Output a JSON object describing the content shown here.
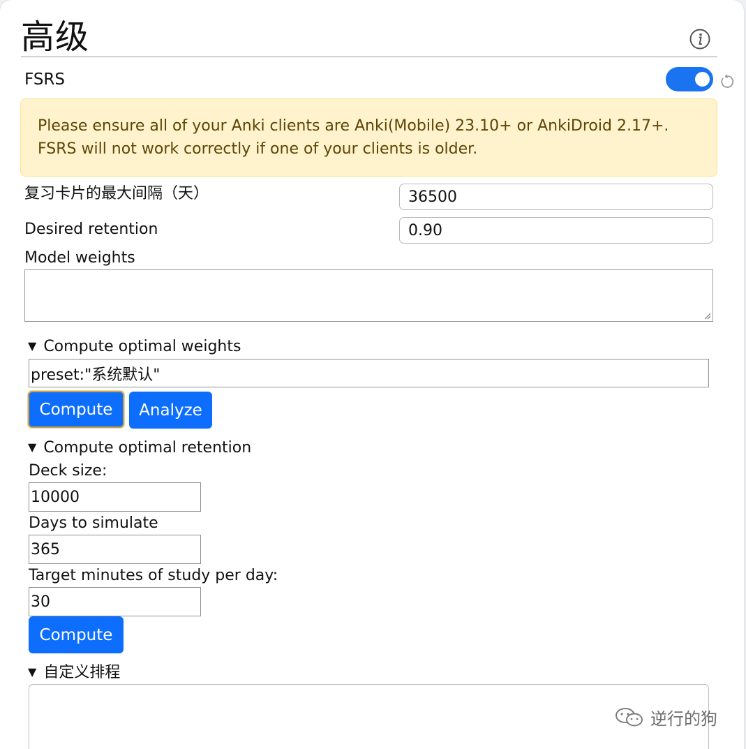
{
  "header": {
    "title": "高级",
    "info_icon": "info-icon"
  },
  "fsrs": {
    "label": "FSRS",
    "enabled": true,
    "toggle_color": "#1a73f0",
    "revert_icon": "revert-icon"
  },
  "warning": {
    "text": "Please ensure all of your Anki clients are Anki(Mobile) 23.10+ or AnkiDroid 2.17+. FSRS will not work correctly if one of your clients is older."
  },
  "settings": {
    "max_interval": {
      "label": "复习卡片的最大间隔（天）",
      "value": "36500"
    },
    "desired_retention": {
      "label": "Desired retention",
      "value": "0.90"
    },
    "model_weights": {
      "label": "Model weights",
      "value": ""
    }
  },
  "optimal_weights": {
    "summary": "Compute optimal weights",
    "search_value": "preset:\"系统默认\"",
    "compute_label": "Compute",
    "analyze_label": "Analyze"
  },
  "optimal_retention": {
    "summary": "Compute optimal retention",
    "deck_size_label": "Deck size:",
    "deck_size_value": "10000",
    "days_label": "Days to simulate",
    "days_value": "365",
    "minutes_label": "Target minutes of study per day:",
    "minutes_value": "30",
    "compute_label": "Compute"
  },
  "custom_scheduling": {
    "summary": "自定义排程"
  },
  "watermark": {
    "text": "逆行的狗",
    "icon": "wechat-icon"
  },
  "colors": {
    "primary_button": "#0d6efd",
    "warning_bg": "#fff3cd",
    "warning_border": "#ffe38a",
    "warning_text": "#5c4606"
  }
}
